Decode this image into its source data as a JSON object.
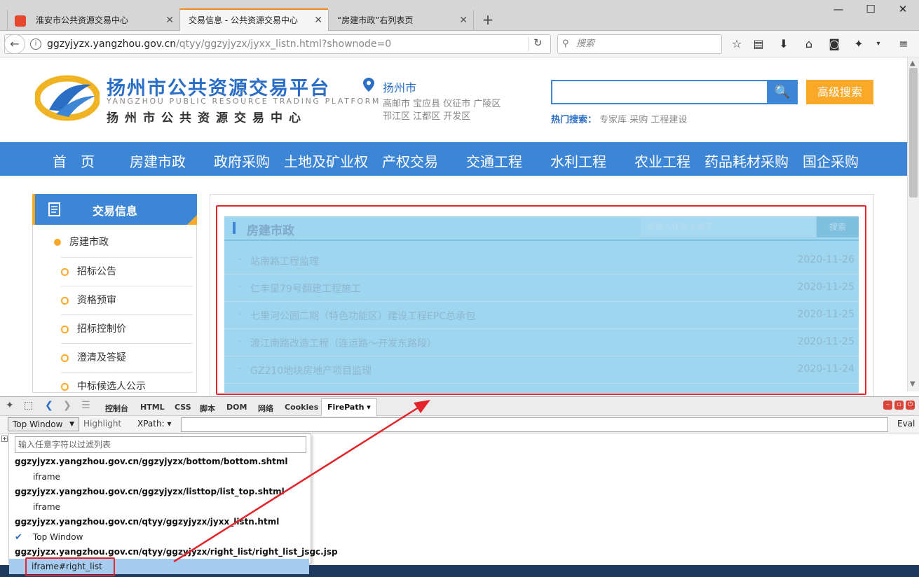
{
  "browser": {
    "tabs": [
      {
        "label": "淮安市公共资源交易中心",
        "close": "✕"
      },
      {
        "label": "交易信息 - 公共资源交易中心",
        "close": "✕"
      },
      {
        "label": "“房建市政”右列表页",
        "close": "✕"
      }
    ],
    "new_tab": "+",
    "window_controls": [
      "—",
      "☐",
      "✕"
    ],
    "url_host": "ggzyjyzx.yangzhou.gov.cn",
    "url_path": "/qtyy/ggzyjyzx/jyxx_listn.html?shownode=0",
    "search_placeholder": "搜索"
  },
  "site": {
    "title": "扬州市公共资源交易平台",
    "subtitle_en": "YANGZHOU PUBLIC RESOURCE TRADING PLATFORM",
    "subtitle_cn": "扬州市公共资源交易中心",
    "city": "扬州市",
    "districts_line1": "高邮市 宝应县 仪征市 广陵区",
    "districts_line2": "邗江区 江都区 开发区",
    "search_button": "🔍",
    "advanced_search": "高级搜索",
    "hot_label": "热门搜索：",
    "hot_terms": "专家库 采购 工程建设"
  },
  "main_nav": [
    "首　页",
    "房建市政",
    "政府采购",
    "土地及矿业权",
    "产权交易",
    "交通工程",
    "水利工程",
    "农业工程",
    "药品耗材采购",
    "国企采购"
  ],
  "sidebar": {
    "header": "交易信息",
    "top_item": "房建市政",
    "items": [
      "招标公告",
      "资格预审",
      "招标控制价",
      "澄清及答疑",
      "中标候选人公示"
    ]
  },
  "list": {
    "title": "房建市政",
    "keyword_placeholder": "请输入搜索关键字",
    "search_button": "搜索",
    "rows": [
      {
        "title": "站南路工程监理",
        "date": "2020-11-26"
      },
      {
        "title": "仁丰里79号翻建工程施工",
        "date": "2020-11-25"
      },
      {
        "title": "七里河公园二期（特色功能区）建设工程EPC总承包",
        "date": "2020-11-25"
      },
      {
        "title": "渡江南路改造工程（连运路～开发东路段）",
        "date": "2020-11-25"
      },
      {
        "title": "GZ210地块房地产项目监理",
        "date": "2020-11-24"
      }
    ]
  },
  "devtools": {
    "tabs": [
      "控制台",
      "HTML",
      "CSS",
      "脚本",
      "DOM",
      "网络",
      "Cookies",
      "FirePath ▾"
    ],
    "frame_select": "Top Window",
    "highlight": "Highlight",
    "xpath_label": "XPath: ▾",
    "eval": "Eval",
    "filter_placeholder": "输入任意字符以过滤列表",
    "frames": [
      {
        "text": "ggzyjyzx.yangzhou.gov.cn/ggzyjyzx/bottom/bottom.shtml",
        "kind": "url"
      },
      {
        "text": "iframe",
        "kind": "frame"
      },
      {
        "text": "ggzyjyzx.yangzhou.gov.cn/ggzyjyzx/listtop/list_top.shtml",
        "kind": "url"
      },
      {
        "text": "iframe",
        "kind": "frame"
      },
      {
        "text": "ggzyjyzx.yangzhou.gov.cn/qtyy/ggzyjyzx/jyxx_listn.html",
        "kind": "url"
      },
      {
        "text": "Top Window",
        "kind": "checked"
      },
      {
        "text": "ggzyjyzx.yangzhou.gov.cn/qtyy/ggzyjyzx/right_list/right_list_jsgc.jsp",
        "kind": "url"
      },
      {
        "text": "iframe#right_list",
        "kind": "selected"
      }
    ]
  },
  "colors": {
    "brand_blue": "#3d86d6",
    "accent_orange": "#f9a927",
    "highlight": "#9fd6ef",
    "annotation_red": "#e3242b"
  }
}
